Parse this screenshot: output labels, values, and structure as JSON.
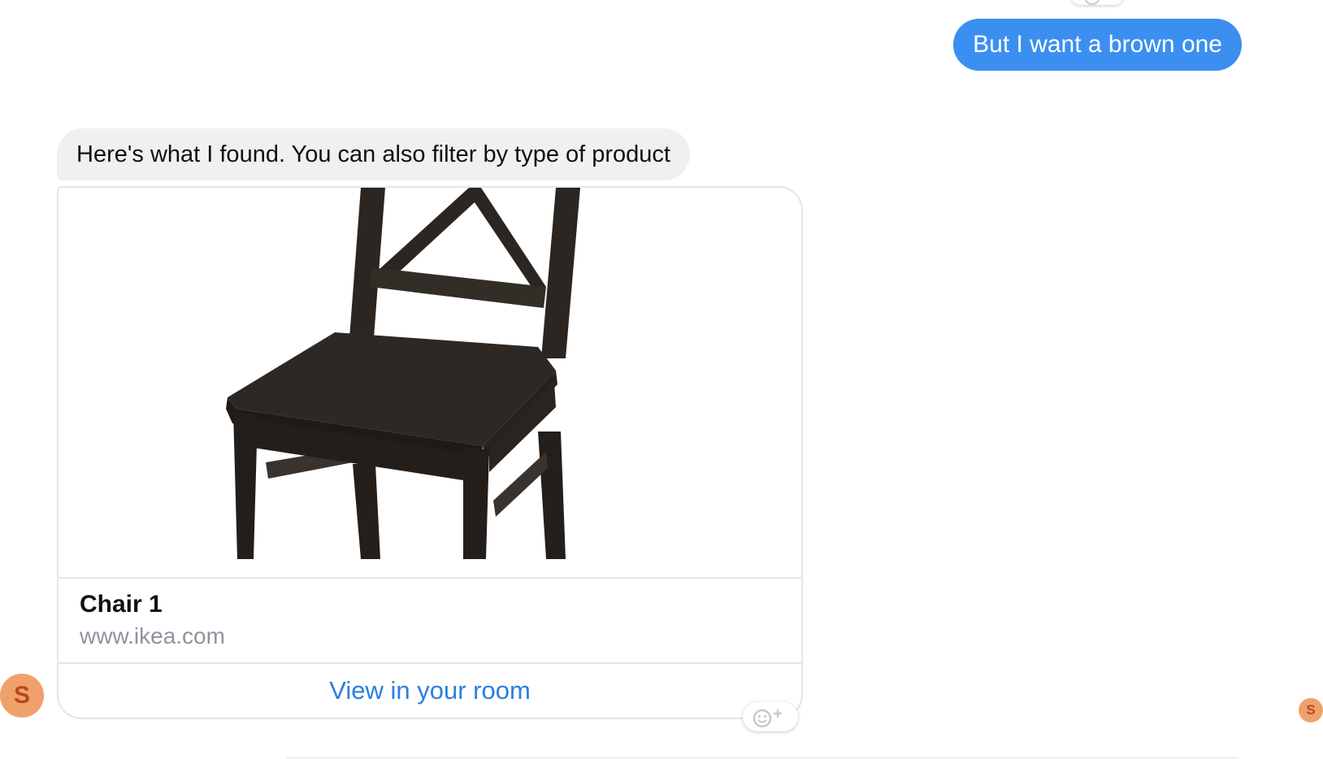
{
  "messages": {
    "outgoing_text": "But I want a brown one",
    "incoming_text": "Here's what I found. You can also filter by type of product"
  },
  "product_card": {
    "image_alt": "dark brown wooden chair",
    "title": "Chair 1",
    "url": "www.ikea.com",
    "action_label": "View in your room"
  },
  "avatar": {
    "initial": "S"
  },
  "colors": {
    "outgoing_bubble": "#3b8ff0",
    "incoming_bubble": "#f0f0f0",
    "link": "#2a7fe0",
    "avatar": "#f0a06a",
    "chair": "#2b2622"
  },
  "icons": {
    "reaction": "add-reaction-icon"
  }
}
